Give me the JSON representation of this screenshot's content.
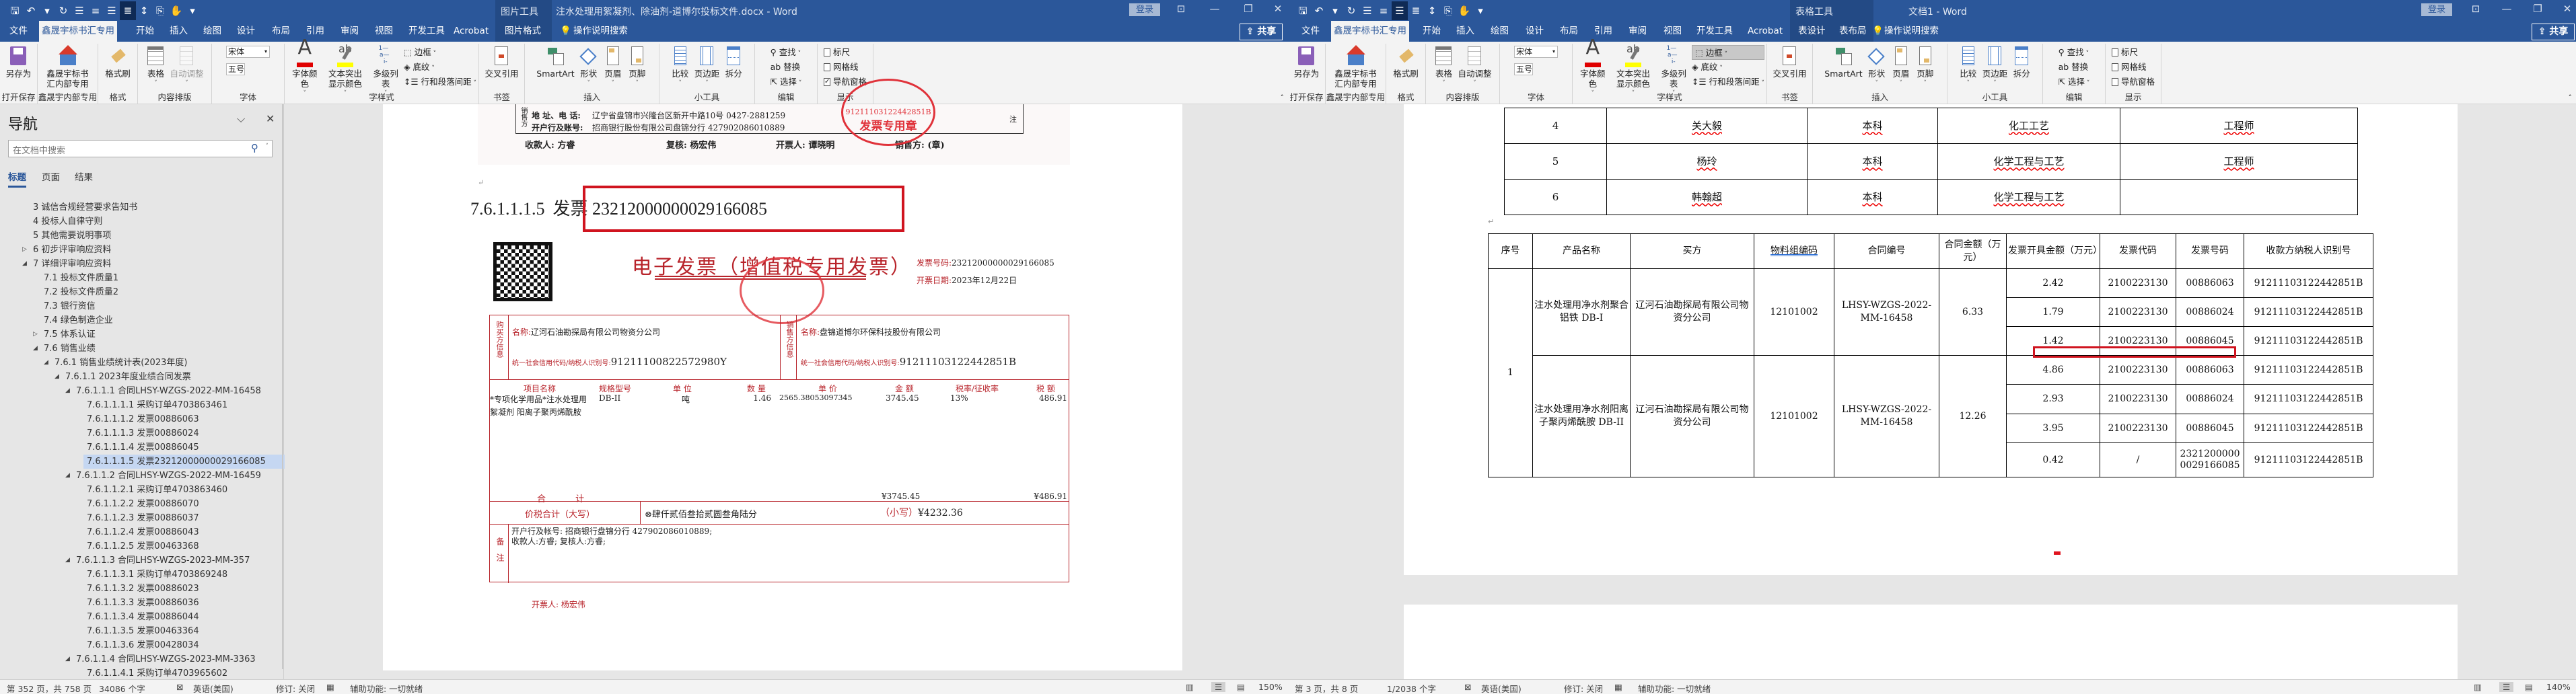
{
  "windows": [
    {
      "title": "注水处理用絮凝剂、除油剂-道博尔投标文件.docx - Word",
      "context_group": "图片工具",
      "tabs": [
        "文件",
        "鑫晟宇标书汇专用",
        "开始",
        "插入",
        "绘图",
        "设计",
        "布局",
        "引用",
        "审阅",
        "视图",
        "开发工具",
        "Acrobat"
      ],
      "context_tabs": [
        "图片格式"
      ],
      "search_label": "操作说明搜索",
      "login": "登录",
      "share": "共享",
      "nav_pane_checked": true,
      "autofit_enabled": false,
      "border_highlight": false,
      "status": {
        "page": "第 352 页，共 758 页",
        "words": "34086 个字",
        "language": "英语(美国)",
        "track": "修订: 关闭",
        "accessibility": "辅助功能: 一切就绪",
        "zoom": "150%"
      }
    },
    {
      "title": "文档1 - Word",
      "context_group": "表格工具",
      "tabs": [
        "文件",
        "鑫晟宇标书汇专用",
        "开始",
        "插入",
        "绘图",
        "设计",
        "布局",
        "引用",
        "审阅",
        "视图",
        "开发工具",
        "Acrobat"
      ],
      "context_tabs": [
        "表设计",
        "表布局"
      ],
      "search_label": "操作说明搜索",
      "login": "登录",
      "share": "共享",
      "nav_pane_checked": false,
      "autofit_enabled": true,
      "border_highlight": true,
      "status": {
        "page": "第 3 页，共 8 页",
        "words": "1/2038 个字",
        "language": "英语(美国)",
        "track": "修订: 关闭",
        "accessibility": "辅助功能: 一切就绪",
        "zoom": "140%"
      }
    }
  ],
  "ribbon": {
    "font_name": "宋体",
    "font_size": "五号",
    "groups": [
      {
        "label": "打开保存",
        "items": [
          {
            "label": "另存为",
            "icon": "save-as-icon"
          }
        ]
      },
      {
        "label": "鑫晟宇内部专用",
        "items": [
          {
            "label": "鑫晟宇标书汇内部专用",
            "icon": "home-icon"
          }
        ]
      },
      {
        "label": "格式",
        "items": [
          {
            "label": "格式刷",
            "icon": "format-painter-icon"
          }
        ]
      },
      {
        "label": "内容排版",
        "items": [
          {
            "label": "表格",
            "icon": "table-icon",
            "dropdown": true
          },
          {
            "label": "自动调整",
            "icon": "autofit-icon",
            "dropdown": true
          }
        ]
      },
      {
        "label": "字体",
        "items": []
      },
      {
        "label": "字样式",
        "items": [
          {
            "label": "字体颜色",
            "icon": "font-color-icon",
            "dropdown": true
          },
          {
            "label": "文本突出显示颜色",
            "icon": "highlight-icon",
            "dropdown": true
          },
          {
            "label": "多级列表",
            "icon": "multilevel-list-icon",
            "dropdown": true
          }
        ],
        "stack": [
          "边框",
          "底纹",
          "行和段落间距"
        ]
      },
      {
        "label": "书签",
        "items": [
          {
            "label": "交叉引用",
            "icon": "cross-reference-icon"
          }
        ]
      },
      {
        "label": "插入",
        "items": [
          {
            "label": "SmartArt",
            "icon": "smartart-icon"
          },
          {
            "label": "形状",
            "icon": "shapes-icon",
            "dropdown": true
          },
          {
            "label": "页眉",
            "icon": "header-icon",
            "dropdown": true
          },
          {
            "label": "页脚",
            "icon": "footer-icon",
            "dropdown": true
          }
        ]
      },
      {
        "label": "小工具",
        "items": [
          {
            "label": "比较",
            "icon": "compare-icon",
            "dropdown": true
          },
          {
            "label": "页边距",
            "icon": "margins-icon",
            "dropdown": true
          },
          {
            "label": "拆分",
            "icon": "split-icon"
          }
        ]
      },
      {
        "label": "编辑",
        "items": [],
        "stack": [
          "查找",
          "替换",
          "选择"
        ]
      },
      {
        "label": "显示",
        "items": [],
        "checks": [
          "标尺",
          "网格线",
          "导航窗格"
        ]
      }
    ],
    "colors": {
      "font_color": "#e00000",
      "highlight": "#ffff00"
    }
  },
  "nav": {
    "title": "导航",
    "search_placeholder": "在文档中搜索",
    "tabs": [
      "标题",
      "页面",
      "结果"
    ],
    "items": [
      {
        "t": "3 诚信合规经营要求告知书",
        "l": 1,
        "s": ""
      },
      {
        "t": "4 投标人自律守则",
        "l": 1,
        "s": ""
      },
      {
        "t": "5 其他需要说明事项",
        "l": 1,
        "s": ""
      },
      {
        "t": "6 初步评审响应资料",
        "l": 1,
        "s": "collapsed"
      },
      {
        "t": "7 详细评审响应资料",
        "l": 1,
        "s": "expanded"
      },
      {
        "t": "7.1 投标文件质量1",
        "l": 2,
        "s": ""
      },
      {
        "t": "7.2 投标文件质量2",
        "l": 2,
        "s": ""
      },
      {
        "t": "7.3 银行资信",
        "l": 2,
        "s": ""
      },
      {
        "t": "7.4 绿色制造企业",
        "l": 2,
        "s": ""
      },
      {
        "t": "7.5 体系认证",
        "l": 2,
        "s": "collapsed"
      },
      {
        "t": "7.6 销售业绩",
        "l": 2,
        "s": "expanded"
      },
      {
        "t": "7.6.1 销售业绩统计表(2023年度)",
        "l": 3,
        "s": "expanded"
      },
      {
        "t": "7.6.1.1 2023年度业绩合同发票",
        "l": 4,
        "s": "expanded"
      },
      {
        "t": "7.6.1.1.1 合同LHSY-WZGS-2022-MM-16458",
        "l": 5,
        "s": "expanded"
      },
      {
        "t": "7.6.1.1.1.1 采购订单4703863461",
        "l": 6,
        "s": ""
      },
      {
        "t": "7.6.1.1.1.2 发票00886063",
        "l": 6,
        "s": ""
      },
      {
        "t": "7.6.1.1.1.3 发票00886024",
        "l": 6,
        "s": ""
      },
      {
        "t": "7.6.1.1.1.4 发票00886045",
        "l": 6,
        "s": ""
      },
      {
        "t": "7.6.1.1.1.5 发票23212000000029166085",
        "l": 6,
        "s": "",
        "selected": true
      },
      {
        "t": "7.6.1.1.2 合同LHSY-WZGS-2022-MM-16459",
        "l": 5,
        "s": "expanded"
      },
      {
        "t": "7.6.1.1.2.1 采购订单4703863460",
        "l": 6,
        "s": ""
      },
      {
        "t": "7.6.1.1.2.2 发票00886070",
        "l": 6,
        "s": ""
      },
      {
        "t": "7.6.1.1.2.3 发票00886037",
        "l": 6,
        "s": ""
      },
      {
        "t": "7.6.1.1.2.4 发票00886043",
        "l": 6,
        "s": ""
      },
      {
        "t": "7.6.1.1.2.5 发票00463368",
        "l": 6,
        "s": ""
      },
      {
        "t": "7.6.1.1.3 合同LHSY-WZGS-2023-MM-357",
        "l": 5,
        "s": "expanded"
      },
      {
        "t": "7.6.1.1.3.1 采购订单4703869248",
        "l": 6,
        "s": ""
      },
      {
        "t": "7.6.1.1.3.2 发票00886023",
        "l": 6,
        "s": ""
      },
      {
        "t": "7.6.1.1.3.3 发票00886036",
        "l": 6,
        "s": ""
      },
      {
        "t": "7.6.1.1.3.4 发票00886044",
        "l": 6,
        "s": ""
      },
      {
        "t": "7.6.1.1.3.5 发票00463364",
        "l": 6,
        "s": ""
      },
      {
        "t": "7.6.1.1.3.6 发票00428034",
        "l": 6,
        "s": ""
      },
      {
        "t": "7.6.1.1.4 合同LHSY-WZGS-2023-MM-3363",
        "l": 5,
        "s": "expanded"
      },
      {
        "t": "7.6.1.1.4.1 采购订单4703965602",
        "l": 6,
        "s": ""
      }
    ]
  },
  "left_doc": {
    "prev_invoice": {
      "seller_tag": "销售方",
      "address_label": "地 址、电 话:",
      "address": "辽宁省盘锦市兴隆台区新开中路10号 0427-2881259",
      "bank_label": "开户行及账号:",
      "bank": "招商银行股份有限公司盘锦分行 427902086010889",
      "note_tag": "注",
      "payee": "收款人: 方睿",
      "reviewer": "复核: 杨宏伟",
      "issuer": "开票人: 谭晓明",
      "seller_seal": "销售方: (章)",
      "stamp_id": "91211103122442851B",
      "stamp_text": "发票专用章"
    },
    "heading_number": "7.6.1.1.1.5",
    "heading_text": "发票 23212000000029166085",
    "invoice": {
      "title": "电子发票（增值税专用发票）",
      "number_label": "发票号码:",
      "number": "23212000000029166085",
      "date_label": "开票日期:",
      "date": "2023年12月22日",
      "buyer_tag": "购买方信息",
      "seller_tag": "销售方信息",
      "buyer_name_label": "名称:",
      "buyer_name": "辽河石油勘探局有限公司物资分公司",
      "buyer_tax_label": "统一社会信用代码/纳税人识别号:",
      "buyer_tax": "91211100822572980Y",
      "seller_name_label": "名称:",
      "seller_name": "盘锦道博尔环保科技股份有限公司",
      "seller_tax_label": "统一社会信用代码/纳税人识别号:",
      "seller_tax": "91211103122442851B",
      "item_headers": [
        "项目名称",
        "规格型号",
        "单 位",
        "数 量",
        "单 价",
        "金 额",
        "税率/征收率",
        "税 额"
      ],
      "item": {
        "name": "*专项化学用品*注水处理用絮凝剂 阳离子聚丙烯酰胺",
        "spec": "DB-II",
        "unit": "吨",
        "qty": "1.46",
        "price": "2565.38053097345",
        "amount": "3745.45",
        "rate": "13%",
        "tax": "486.91"
      },
      "total_label": "合 计",
      "total_amount": "¥3745.45",
      "total_tax": "¥486.91",
      "grand_label": "价税合计（大写）",
      "grand_words": "肆仟贰佰叁拾贰圆叁角陆分",
      "grand_small_label": "（小写）",
      "grand_small": "¥4232.36",
      "remark_tag": "备注",
      "remark_lines": [
        "开户行及帐号: 招商银行盘锦分行 427902086010889;",
        "收款人:方睿;      复核人:方睿;"
      ],
      "issuer": "开票人: 杨宏伟"
    }
  },
  "right_doc": {
    "staff_rows": [
      [
        "4",
        "关大毅",
        "本科",
        "化工工艺",
        "工程师"
      ],
      [
        "5",
        "杨玲",
        "本科",
        "化学工程与工艺",
        "工程师"
      ],
      [
        "6",
        "韩翰超",
        "本科",
        "化学工程与工艺",
        ""
      ]
    ],
    "sales_headers": [
      "序号",
      "产品名称",
      "买方",
      "物料组编码",
      "合同编号",
      "合同金额（万元）",
      "发票开具金额（万元）",
      "发票代码",
      "发票号码",
      "收款方纳税人识别号"
    ],
    "sales_groups": [
      {
        "seq": "1",
        "product": "注水处理用净水剂聚合铝铁 DB-I",
        "buyer": "辽河石油勘探局有限公司物资分公司",
        "material": "12101002",
        "contract": "LHSY-WZGS-2022-MM-16458",
        "amount": "6.33",
        "invoices": [
          {
            "amount": "2.42",
            "code": "2100223130",
            "number": "00886063",
            "taxid": "91211103122442851B"
          },
          {
            "amount": "1.79",
            "code": "2100223130",
            "number": "00886024",
            "taxid": "91211103122442851B"
          },
          {
            "amount": "1.42",
            "code": "2100223130",
            "number": "00886045",
            "taxid": "91211103122442851B"
          }
        ]
      },
      {
        "seq": "1",
        "product": "注水处理用净水剂阳离子聚丙烯酰胺 DB-II",
        "buyer": "辽河石油勘探局有限公司物资分公司",
        "material": "12101002",
        "contract": "LHSY-WZGS-2022-MM-16458",
        "amount": "12.26",
        "invoices": [
          {
            "amount": "4.86",
            "code": "2100223130",
            "number": "00886063",
            "taxid": "91211103122442851B"
          },
          {
            "amount": "2.93",
            "code": "2100223130",
            "number": "00886024",
            "taxid": "91211103122442851B"
          },
          {
            "amount": "3.95",
            "code": "2100223130",
            "number": "00886045",
            "taxid": "91211103122442851B"
          },
          {
            "amount": "0.42",
            "code": "/",
            "number": "23212000000029166085",
            "taxid": "91211103122442851B"
          }
        ]
      }
    ]
  }
}
